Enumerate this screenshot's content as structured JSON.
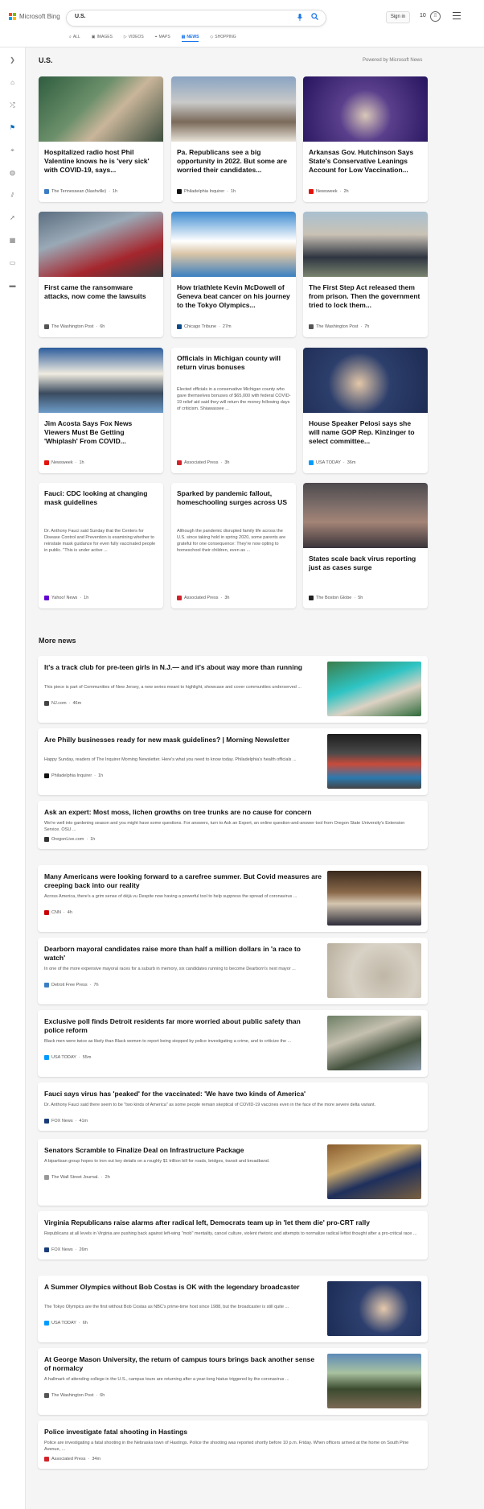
{
  "header": {
    "brand": "Microsoft Bing",
    "query": "U.S.",
    "signin": "Sign in",
    "rewards_count": "10",
    "scopes": [
      "ALL",
      "IMAGES",
      "VIDEOS",
      "MAPS",
      "NEWS",
      "SHOPPING"
    ],
    "active_scope": "NEWS",
    "colors": {
      "accent": "#1a73e8",
      "logo_red": "#f25022",
      "logo_green": "#7fba00",
      "logo_blue": "#00a4ef",
      "logo_yellow": "#ffb900"
    }
  },
  "section": {
    "title": "U.S.",
    "powered": "Powered by Microsoft News"
  },
  "cards": [
    {
      "title": "Hospitalized radio host Phil Valentine knows he is 'very sick' with COVID-19, says...",
      "desc": "",
      "source": "The Tennessean (Nashville)",
      "time": "1h",
      "logo_color": "#3b7dc4"
    },
    {
      "title": "Pa. Republicans see a big opportunity in 2022. But some are worried their candidates...",
      "desc": "",
      "source": "Philadelphia Inquirer",
      "time": "1h",
      "logo_color": "#111111"
    },
    {
      "title": "Arkansas Gov. Hutchinson Says State's Conservative Leanings Account for Low Vaccination...",
      "desc": "",
      "source": "Newsweek",
      "time": "2h",
      "logo_color": "#e3120b"
    },
    {
      "title": "First came the ransomware attacks, now come the lawsuits",
      "desc": "",
      "source": "The Washington Post",
      "time": "6h",
      "logo_color": "#555555"
    },
    {
      "title": "How triathlete Kevin McDowell of Geneva beat cancer on his journey to the Tokyo Olympics...",
      "desc": "",
      "source": "Chicago Tribune",
      "time": "27m",
      "logo_color": "#0d4a8a"
    },
    {
      "title": "The First Step Act released them from prison. Then the government tried to lock them...",
      "desc": "",
      "source": "The Washington Post",
      "time": "7h",
      "logo_color": "#555555"
    },
    {
      "title": "Jim Acosta Says Fox News Viewers Must Be Getting 'Whiplash' From COVID...",
      "desc": "",
      "source": "Newsweek",
      "time": "1h",
      "logo_color": "#e3120b"
    },
    {
      "title": "Officials in Michigan county will return virus bonuses",
      "desc": "Elected officials in a conservative Michigan county who gave themselves bonuses of $65,000 with federal COVID-19 relief aid said they will return the money following days of criticism. Shiawassee ...",
      "source": "Associated Press",
      "time": "3h",
      "logo_color": "#d2232a"
    },
    {
      "title": "House Speaker Pelosi says she will name GOP Rep. Kinzinger to select committee...",
      "desc": "",
      "source": "USA TODAY",
      "time": "36m",
      "logo_color": "#009bff"
    },
    {
      "title": "Fauci: CDC looking at changing mask guidelines",
      "desc": "Dr. Anthony Fauci said Sunday that the Centers for Disease Control and Prevention is examining whether to reinstate mask guidance for even fully vaccinated people in public. \"This is under active ...",
      "source": "Yahoo! News",
      "time": "1h",
      "logo_color": "#6001d2"
    },
    {
      "title": "Sparked by pandemic fallout, homeschooling surges across US",
      "desc": "Although the pandemic disrupted family life across the U.S. since taking hold in spring 2020, some parents are grateful for one consequence: They're now opting to homeschool their children, even as ...",
      "source": "Associated Press",
      "time": "3h",
      "logo_color": "#d2232a"
    },
    {
      "title": "States scale back virus reporting just as cases surge",
      "desc": "",
      "source": "The Boston Globe",
      "time": "5h",
      "logo_color": "#222222"
    }
  ],
  "more": {
    "title": "More news",
    "items": [
      {
        "title": "It's a track club for pre-teen girls in N.J.— and it's about way more than running",
        "desc": "This piece is part of Communities of New Jersey, a new series meant to highlight, showcase and cover communities underserved ...",
        "source": "NJ.com",
        "time": "46m",
        "logo_color": "#444444",
        "has_image": true
      },
      {
        "title": "Are Philly businesses ready for new mask guidelines? | Morning Newsletter",
        "desc": "Happy Sunday, readers of The Inquirer Morning Newsletter. Here's what you need to know today. Philadelphia's health officials ...",
        "source": "Philadelphia Inquirer",
        "time": "1h",
        "logo_color": "#111111",
        "has_image": true
      },
      {
        "title": "Ask an expert: Most moss, lichen growths on tree trunks are no cause for concern",
        "desc": "We're well into gardening season and you might have some questions. For answers, turn to Ask an Expert, an online question-and-answer tool from Oregon State University's Extension Service. OSU ...",
        "source": "OregonLive.com",
        "time": "1h",
        "logo_color": "#333333",
        "has_image": false
      },
      {
        "title": "Many Americans were looking forward to a carefree summer. But Covid measures are creeping back into our reality",
        "desc": "Across America, there's a grim sense of déjà vu Despite now having a powerful tool to help suppress the spread of coronavirus ...",
        "source": "CNN",
        "time": "4h",
        "logo_color": "#cc0000",
        "has_image": true
      },
      {
        "title": "Dearborn mayoral candidates raise more than half a million dollars in 'a race to watch'",
        "desc": "In one of the more expensive mayoral races for a suburb in memory, six candidates running to become Dearborn's next mayor ...",
        "source": "Detroit Free Press",
        "time": "7h",
        "logo_color": "#3b7dc4",
        "has_image": true
      },
      {
        "title": "Exclusive poll finds Detroit residents far more worried about public safety than police reform",
        "desc": "Black men were twice as likely than Black women to report being stopped by police investigating a crime, and to criticize the ...",
        "source": "USA TODAY",
        "time": "55m",
        "logo_color": "#009bff",
        "has_image": true
      },
      {
        "title": "Fauci says virus has 'peaked' for the vaccinated: 'We have two kinds of America'",
        "desc": "Dr. Anthony Fauci said there seem to be \"two kinds of America\" as some people remain skeptical of COVID-19 vaccines even in the face of the more severe delta variant.",
        "source": "FOX News",
        "time": "41m",
        "logo_color": "#1a3c7a",
        "has_image": false
      },
      {
        "title": "Senators Scramble to Finalize Deal on Infrastructure Package",
        "desc": "A bipartisan group hopes to iron out key details on a roughly $1 trillion bill for roads, bridges, transit and broadband.",
        "source": "The Wall Street Journal.",
        "time": "2h",
        "logo_color": "#999999",
        "has_image": true
      },
      {
        "title": "Virginia Republicans raise alarms after radical left, Democrats team up in 'let them die' pro-CRT rally",
        "desc": "Republicans at all levels in Virginia are pushing back against left-wing \"mob\" mentality, cancel culture, violent rhetoric and attempts to normalize radical leftist thought after a pro-critical race ...",
        "source": "FOX News",
        "time": "26m",
        "logo_color": "#1a3c7a",
        "has_image": false
      },
      {
        "title": "A Summer Olympics without Bob Costas is OK with the legendary broadcaster",
        "desc": "The Tokyo Olympics are the first without Bob Costas as NBC's prime-time host since 1988, but the broadcaster is still quite ...",
        "source": "USA TODAY",
        "time": "6h",
        "logo_color": "#009bff",
        "has_image": true
      },
      {
        "title": "At George Mason University, the return of campus tours brings back another sense of normalcy",
        "desc": "A hallmark of attending college in the U.S., campus tours are returning after a year-long hiatus triggered by the coronavirus ...",
        "source": "The Washington Post",
        "time": "6h",
        "logo_color": "#555555",
        "has_image": true
      },
      {
        "title": "Police investigate fatal shooting in Hastings",
        "desc": "Police are investigating a fatal shooting in the Nebraska town of Hastings. Police the shooting was reported shortly before 10 p.m. Friday. When officers arrived at the home on South Pine Avenue, ...",
        "source": "Associated Press",
        "time": "34m",
        "logo_color": "#d2232a",
        "has_image": false
      }
    ]
  }
}
